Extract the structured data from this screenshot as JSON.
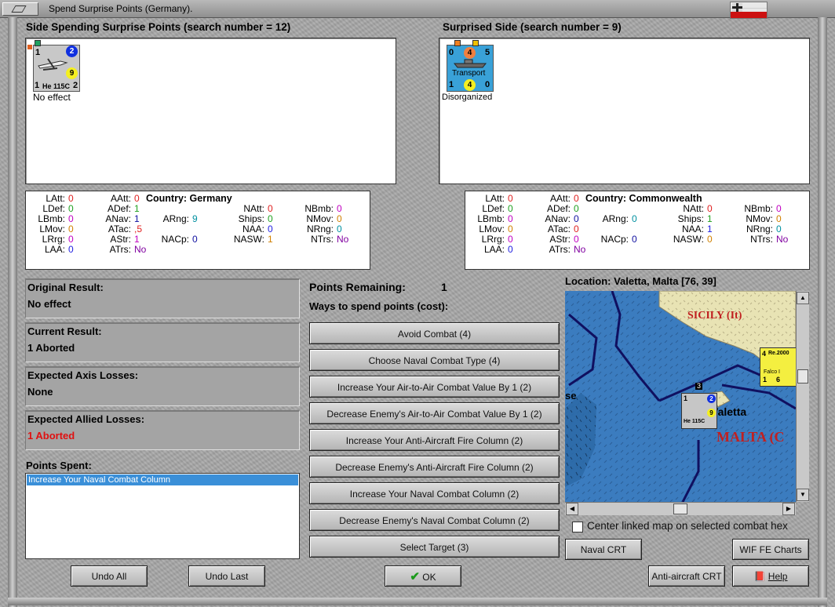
{
  "window": {
    "title": "Spend Surprise Points (Germany)."
  },
  "left_side": {
    "heading": "Side Spending Surprise Points (search number = 12)",
    "unit": {
      "name": "He 115C",
      "top_left": "1",
      "top_right": "2",
      "center_value": "9",
      "bottom_left": "1",
      "bottom_right": "2",
      "status": "No effect"
    },
    "country_label": "Country: Germany",
    "stats": [
      {
        "k": "LAtt:",
        "v": "0",
        "c": "#e02020"
      },
      {
        "k": "LDef:",
        "v": "0",
        "c": "#20a020"
      },
      {
        "k": "LBmb:",
        "v": "0",
        "c": "#c000c0"
      },
      {
        "k": "LMov:",
        "v": "0",
        "c": "#d08000"
      },
      {
        "k": "LRrg:",
        "v": "0",
        "c": "#c000c0"
      },
      {
        "k": "LAA:",
        "v": "0",
        "c": "#2020e0"
      },
      {
        "k": "AAtt:",
        "v": "0",
        "c": "#e02020"
      },
      {
        "k": "ADef:",
        "v": "1",
        "c": "#20a020"
      },
      {
        "k": "ANav:",
        "v": "1",
        "c": "#1010a0"
      },
      {
        "k": "ATac:",
        "v": ",5",
        "c": "#e02020"
      },
      {
        "k": "AStr:",
        "v": "1",
        "c": "#c000c0"
      },
      {
        "k": "ATrs:",
        "v": "No",
        "c": "#8000a0"
      },
      {
        "k": "ARng:",
        "v": "9",
        "c": "#0090a0"
      },
      {
        "k": "NACp:",
        "v": "0",
        "c": "#1010a0"
      },
      {
        "k": "NAtt:",
        "v": "0",
        "c": "#e02020"
      },
      {
        "k": "Ships:",
        "v": "0",
        "c": "#20a020"
      },
      {
        "k": "NAA:",
        "v": "0",
        "c": "#2020e0"
      },
      {
        "k": "NASW:",
        "v": "1",
        "c": "#d08000"
      },
      {
        "k": "NBmb:",
        "v": "0",
        "c": "#c000c0"
      },
      {
        "k": "NMov:",
        "v": "0",
        "c": "#d08000"
      },
      {
        "k": "NRng:",
        "v": "0",
        "c": "#0090a0"
      },
      {
        "k": "NTrs:",
        "v": "No",
        "c": "#8000a0"
      }
    ]
  },
  "right_side": {
    "heading": "Surprised Side (search number = 9)",
    "unit": {
      "name": "Transport",
      "top_left": "0",
      "top_center": "4",
      "top_right": "5",
      "bottom_left": "1",
      "bottom_center": "4",
      "bottom_right": "0",
      "status": "Disorganized"
    },
    "country_label": "Country: Commonwealth",
    "stats": [
      {
        "k": "LAtt:",
        "v": "0",
        "c": "#e02020"
      },
      {
        "k": "LDef:",
        "v": "0",
        "c": "#20a020"
      },
      {
        "k": "LBmb:",
        "v": "0",
        "c": "#c000c0"
      },
      {
        "k": "LMov:",
        "v": "0",
        "c": "#d08000"
      },
      {
        "k": "LRrg:",
        "v": "0",
        "c": "#c000c0"
      },
      {
        "k": "LAA:",
        "v": "0",
        "c": "#2020e0"
      },
      {
        "k": "AAtt:",
        "v": "0",
        "c": "#e02020"
      },
      {
        "k": "ADef:",
        "v": "0",
        "c": "#20a020"
      },
      {
        "k": "ANav:",
        "v": "0",
        "c": "#1010a0"
      },
      {
        "k": "ATac:",
        "v": "0",
        "c": "#e02020"
      },
      {
        "k": "AStr:",
        "v": "0",
        "c": "#c000c0"
      },
      {
        "k": "ATrs:",
        "v": "No",
        "c": "#8000a0"
      },
      {
        "k": "ARng:",
        "v": "0",
        "c": "#0090a0"
      },
      {
        "k": "NACp:",
        "v": "0",
        "c": "#1010a0"
      },
      {
        "k": "NAtt:",
        "v": "0",
        "c": "#e02020"
      },
      {
        "k": "Ships:",
        "v": "1",
        "c": "#20a020"
      },
      {
        "k": "NAA:",
        "v": "1",
        "c": "#2020e0"
      },
      {
        "k": "NASW:",
        "v": "0",
        "c": "#d08000"
      },
      {
        "k": "NBmb:",
        "v": "0",
        "c": "#c000c0"
      },
      {
        "k": "NMov:",
        "v": "0",
        "c": "#d08000"
      },
      {
        "k": "NRng:",
        "v": "0",
        "c": "#0090a0"
      },
      {
        "k": "NTrs:",
        "v": "No",
        "c": "#8000a0"
      }
    ]
  },
  "results": {
    "original_label": "Original Result:",
    "original_value": "No effect",
    "current_label": "Current Result:",
    "current_value": "1 Aborted",
    "axis_label": "Expected Axis Losses:",
    "axis_value": "None",
    "allied_label": "Expected Allied Losses:",
    "allied_value": "1 Aborted",
    "allied_color": "#e01010"
  },
  "points_spent": {
    "label": "Points Spent:",
    "items": [
      "Increase Your Naval Combat Column"
    ]
  },
  "spend": {
    "remaining_label": "Points Remaining:",
    "remaining_value": "1",
    "ways_label": "Ways to spend points (cost):",
    "options": [
      "Avoid Combat (4)",
      "Choose Naval Combat Type (4)",
      "Increase Your Air-to-Air Combat Value By 1 (2)",
      "Decrease Enemy's Air-to-Air Combat Value By 1 (2)",
      "Increase Your Anti-Aircraft Fire Column (2)",
      "Decrease Enemy's Anti-Aircraft Fire Column (2)",
      "Increase Your Naval Combat Column (2)",
      "Decrease Enemy's Naval Combat Column (2)",
      "Select Target (3)"
    ]
  },
  "map": {
    "location_label": "Location: Valetta, Malta [76, 39]",
    "sicily_label": "SICILY (It)",
    "valetta_label": "Valetta",
    "malta_label": "MALTA (C",
    "partial_label": "se",
    "stack_count": "3",
    "italian_unit": {
      "name": "Re.2000",
      "sub": "Falco I",
      "top": "4",
      "bottom_left": "1",
      "bottom_right": "6"
    },
    "center_checkbox_label": "Center linked map on selected combat hex"
  },
  "buttons": {
    "undo_all": "Undo All",
    "undo_last": "Undo Last",
    "ok": "OK",
    "naval_crt": "Naval CRT",
    "wif_charts": "WIF FE Charts",
    "aa_crt": "Anti-aircraft CRT",
    "help": "Help"
  }
}
